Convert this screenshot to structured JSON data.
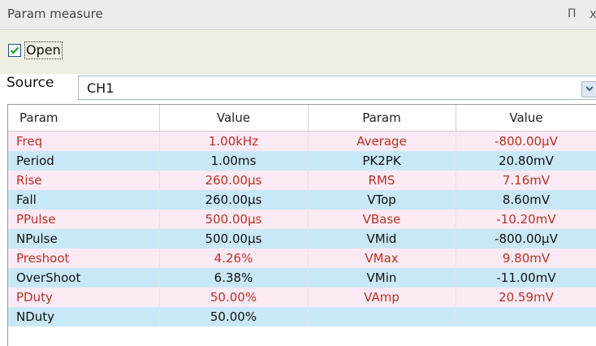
{
  "panel": {
    "title": "Param measure",
    "pin_glyph": "Π",
    "close_glyph": "x"
  },
  "toolbar": {
    "open_label": "Open",
    "open_checked": true
  },
  "source": {
    "label": "Source",
    "value": "CH1"
  },
  "table": {
    "headers": [
      "Param",
      "Value",
      "Param",
      "Value"
    ],
    "rows": [
      [
        "Freq",
        "1.00kHz",
        "Average",
        "-800.00μV"
      ],
      [
        "Period",
        "1.00ms",
        "PK2PK",
        "20.80mV"
      ],
      [
        "Rise",
        "260.00μs",
        "RMS",
        "7.16mV"
      ],
      [
        "Fall",
        "260.00μs",
        "VTop",
        "8.60mV"
      ],
      [
        "PPulse",
        "500.00μs",
        "VBase",
        "-10.20mV"
      ],
      [
        "NPulse",
        "500.00μs",
        "VMid",
        "-800.00μV"
      ],
      [
        "Preshoot",
        "4.26%",
        "VMax",
        "9.80mV"
      ],
      [
        "OverShoot",
        "6.38%",
        "VMin",
        "-11.00mV"
      ],
      [
        "PDuty",
        "50.00%",
        "VAmp",
        "20.59mV"
      ],
      [
        "NDuty",
        "50.00%",
        "",
        ""
      ]
    ]
  },
  "colors": {
    "odd_row_bg": "#fbeaf3",
    "odd_row_text": "#b63225",
    "even_row_bg": "#c9e8f6"
  }
}
